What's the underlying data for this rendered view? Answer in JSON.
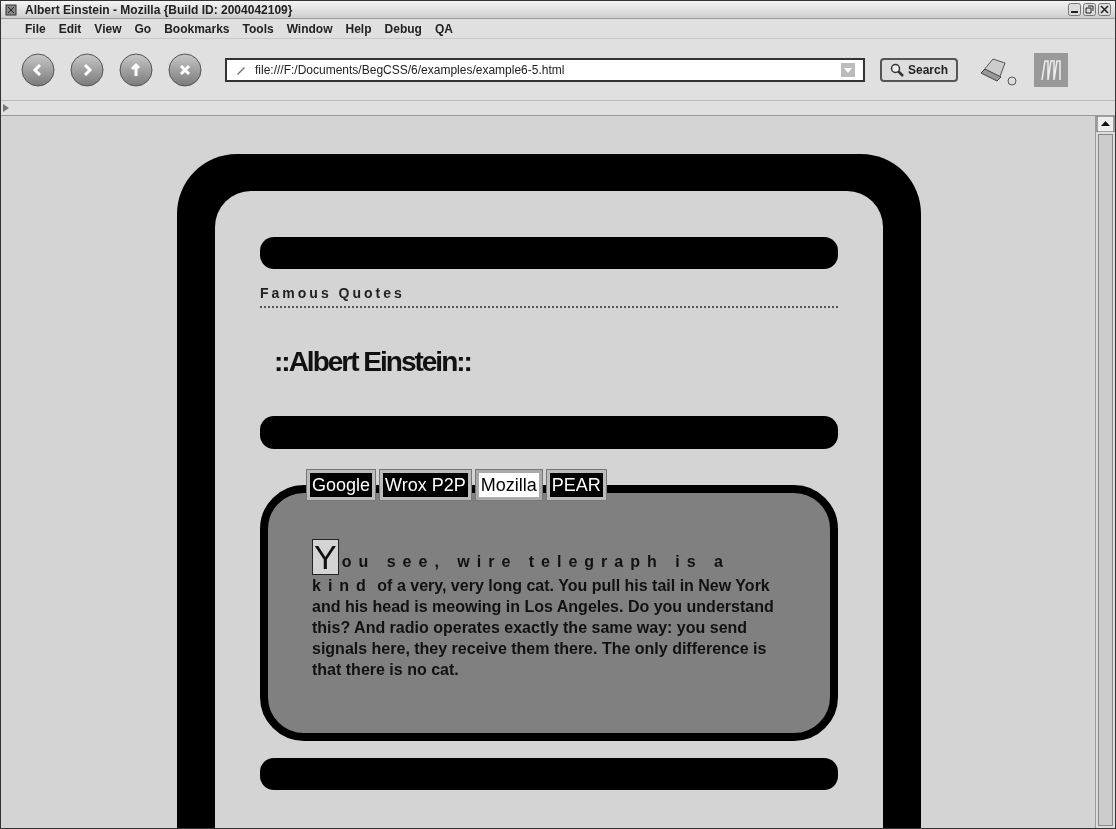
{
  "window": {
    "title": "Albert Einstein - Mozilla {Build ID: 2004042109}"
  },
  "menu": [
    "File",
    "Edit",
    "View",
    "Go",
    "Bookmarks",
    "Tools",
    "Window",
    "Help",
    "Debug",
    "QA"
  ],
  "address_bar": {
    "value": "file:///F:/Documents/BegCSS/6/examples/example6-5.html"
  },
  "search_button": "Search",
  "page": {
    "heading": "Famous Quotes",
    "title": "::Albert Einstein::",
    "tabs": [
      {
        "label": "Google",
        "selected": false
      },
      {
        "label": "Wrox P2P",
        "selected": false
      },
      {
        "label": "Mozilla",
        "selected": true
      },
      {
        "label": "PEAR",
        "selected": false
      }
    ],
    "quote": {
      "drop_cap": "Y",
      "first_line": "ou see, wire telegraph is a kind",
      "rest": "of a very, very long cat. You pull his tail in New York and his head is meowing in Los Angeles. Do you understand this? And radio operates exactly the same way: you send signals here, they receive them there. The only difference is that there is no cat."
    }
  }
}
